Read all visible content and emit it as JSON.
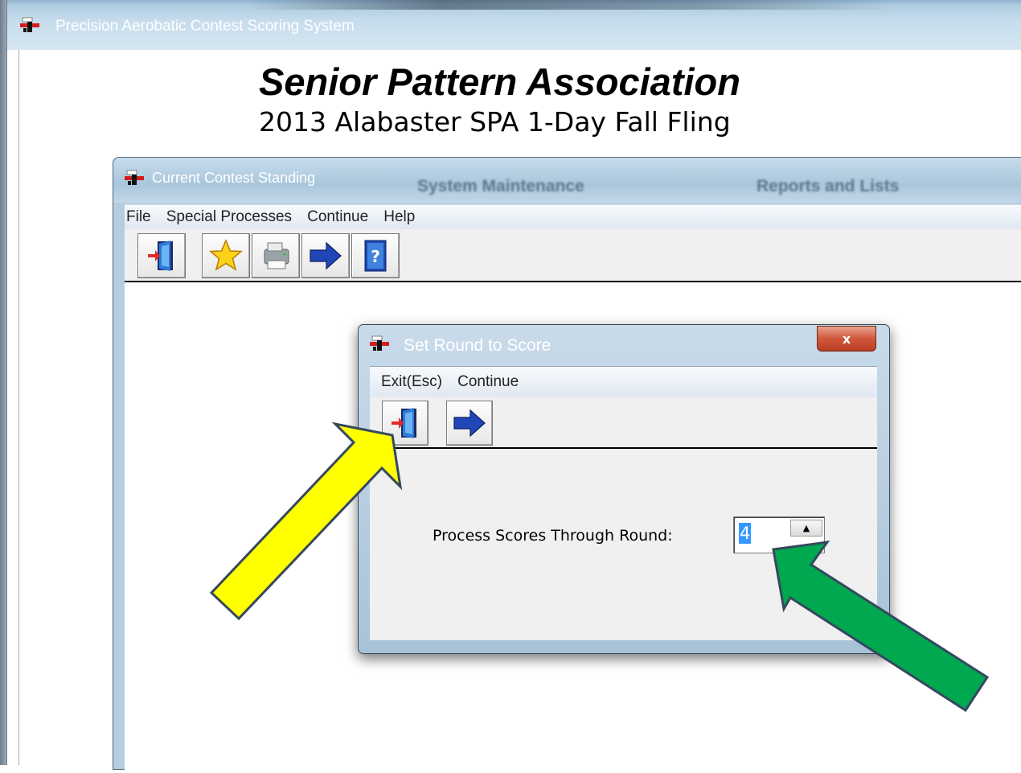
{
  "main_window": {
    "title": "Precision Aerobatic Contest Scoring System"
  },
  "heading": {
    "title": "Senior Pattern Association",
    "subtitle": "2013 Alabaster SPA 1-Day Fall Fling"
  },
  "standings_window": {
    "title": "Current Contest Standing",
    "background_tabs": [
      "System Maintenance",
      "Reports and Lists"
    ],
    "menu": [
      "File",
      "Special Processes",
      "Continue",
      "Help"
    ],
    "toolbar_icons": [
      "exit-door-icon",
      "star-icon",
      "printer-icon",
      "right-arrow-icon",
      "help-book-icon"
    ]
  },
  "dialog": {
    "title": "Set Round to Score",
    "close_glyph": "x",
    "menu": [
      "Exit(Esc)",
      "Continue"
    ],
    "toolbar_icons": [
      "exit-door-icon",
      "right-arrow-icon"
    ],
    "field_label": "Process Scores Through Round:",
    "field_value": "4",
    "spin_up_glyph": "▲"
  },
  "annotations": {
    "yellow": "#ffff00",
    "green": "#00a850",
    "outline": "#34495e"
  }
}
